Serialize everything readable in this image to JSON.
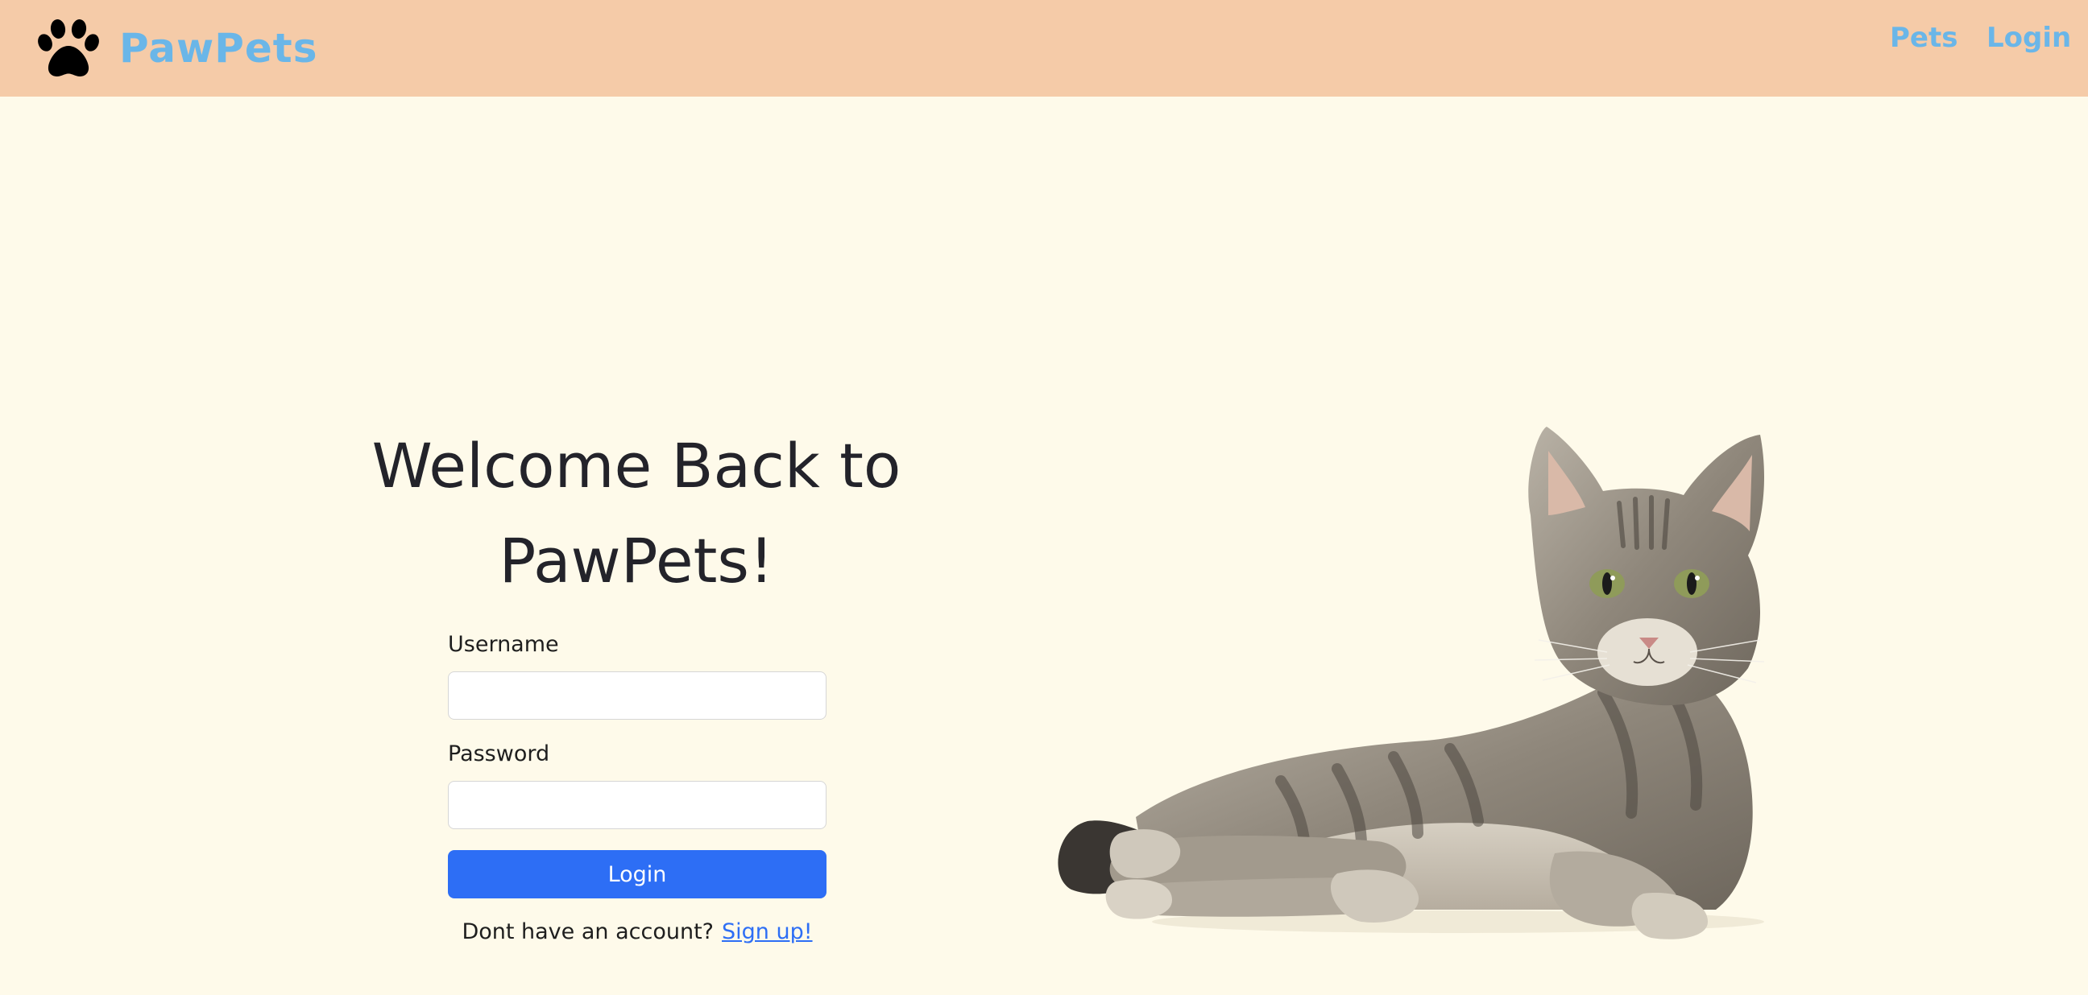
{
  "navbar": {
    "brand_name": "PawPets",
    "brand_icon": "paw-icon",
    "links": {
      "pets": "Pets",
      "login": "Login"
    }
  },
  "login": {
    "title_line1": "Welcome Back to",
    "title_line2": "PawPets!",
    "username_label": "Username",
    "username_value": "",
    "password_label": "Password",
    "password_value": "",
    "submit_label": "Login",
    "signup_prompt": "Dont have an account?",
    "signup_link": "Sign up!"
  },
  "hero_image": {
    "subject": "tabby-cat-lying-down"
  },
  "colors": {
    "page_background": "#fefaea",
    "navbar_background": "#f5cba8",
    "brand_link": "#6ab6e8",
    "primary_button": "#2d6ef5",
    "heading_text": "#23232a"
  }
}
